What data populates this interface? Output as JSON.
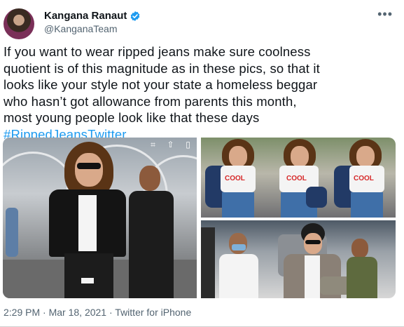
{
  "author": {
    "name": "Kangana Ranaut",
    "handle": "@KanganaTeam",
    "verified": true
  },
  "tweet": {
    "text": "If you want to wear ripped jeans make sure coolness\nquotient is of this magnitude as in these pics, so that it\nlooks like your style not your state a homeless beggar\nwho hasn’t got allowance from parents this month,\nmost young people look like that these days",
    "hashtag": "#RippedJeansTwitter"
  },
  "media": {
    "shirt_text": "COOL"
  },
  "meta": {
    "time": "2:29 PM",
    "sep1": "·",
    "date": "Mar 18, 2021",
    "sep2": "·",
    "source": "Twitter for iPhone"
  },
  "colors": {
    "link": "#1d9bf0",
    "verified": "#1d9bf0",
    "secondary_text": "#536471"
  }
}
